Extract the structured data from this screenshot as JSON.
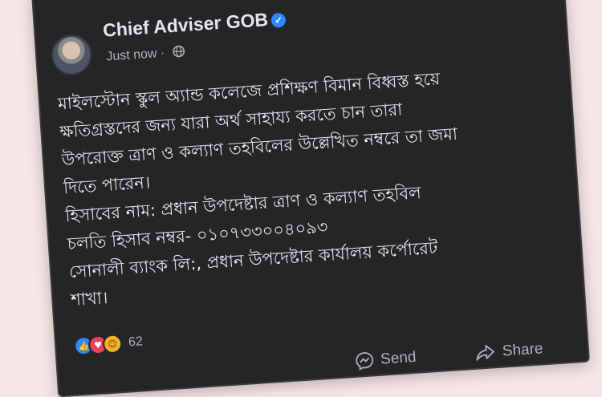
{
  "post": {
    "author": "Chief Adviser GOB",
    "timestamp": "Just now",
    "separator": "·",
    "lines": [
      "মাইলস্টোন স্কুল অ্যান্ড কলেজে প্রশিক্ষণ বিমান বিধ্বস্ত হয়ে",
      "ক্ষতিগ্রস্তদের জন্য যারা অর্থ সাহায্য করতে চান তারা",
      "উপরোক্ত ত্রাণ ও কল্যাণ তহবিলের উল্লেখিত নম্বরে তা জমা",
      "দিতে পারেন।",
      "হিসাবের নাম: প্রধান উপদেষ্টার ত্রাণ ও কল্যাণ তহবিল",
      "চলতি হিসাব নম্বর- ০১০৭৩৩০০৪০৯৩",
      "সোনালী ব্যাংক লি:, প্রধান উপদেষ্টার কার্যালয় কর্পোরেট",
      "শাখা।"
    ],
    "reaction_count": "62",
    "reactions": [
      "like",
      "love",
      "haha"
    ]
  },
  "actions": {
    "send_label": "Send",
    "share_label": "Share"
  },
  "colors": {
    "card_bg": "#242526",
    "page_bg": "#f7e6e6",
    "text_primary": "#e4e6eb",
    "text_secondary": "#b0b3b8",
    "verified": "#2d88ff"
  },
  "icons": [
    "verified-badge-icon",
    "globe-icon",
    "like-icon",
    "love-icon",
    "haha-icon",
    "send-icon",
    "share-icon"
  ]
}
